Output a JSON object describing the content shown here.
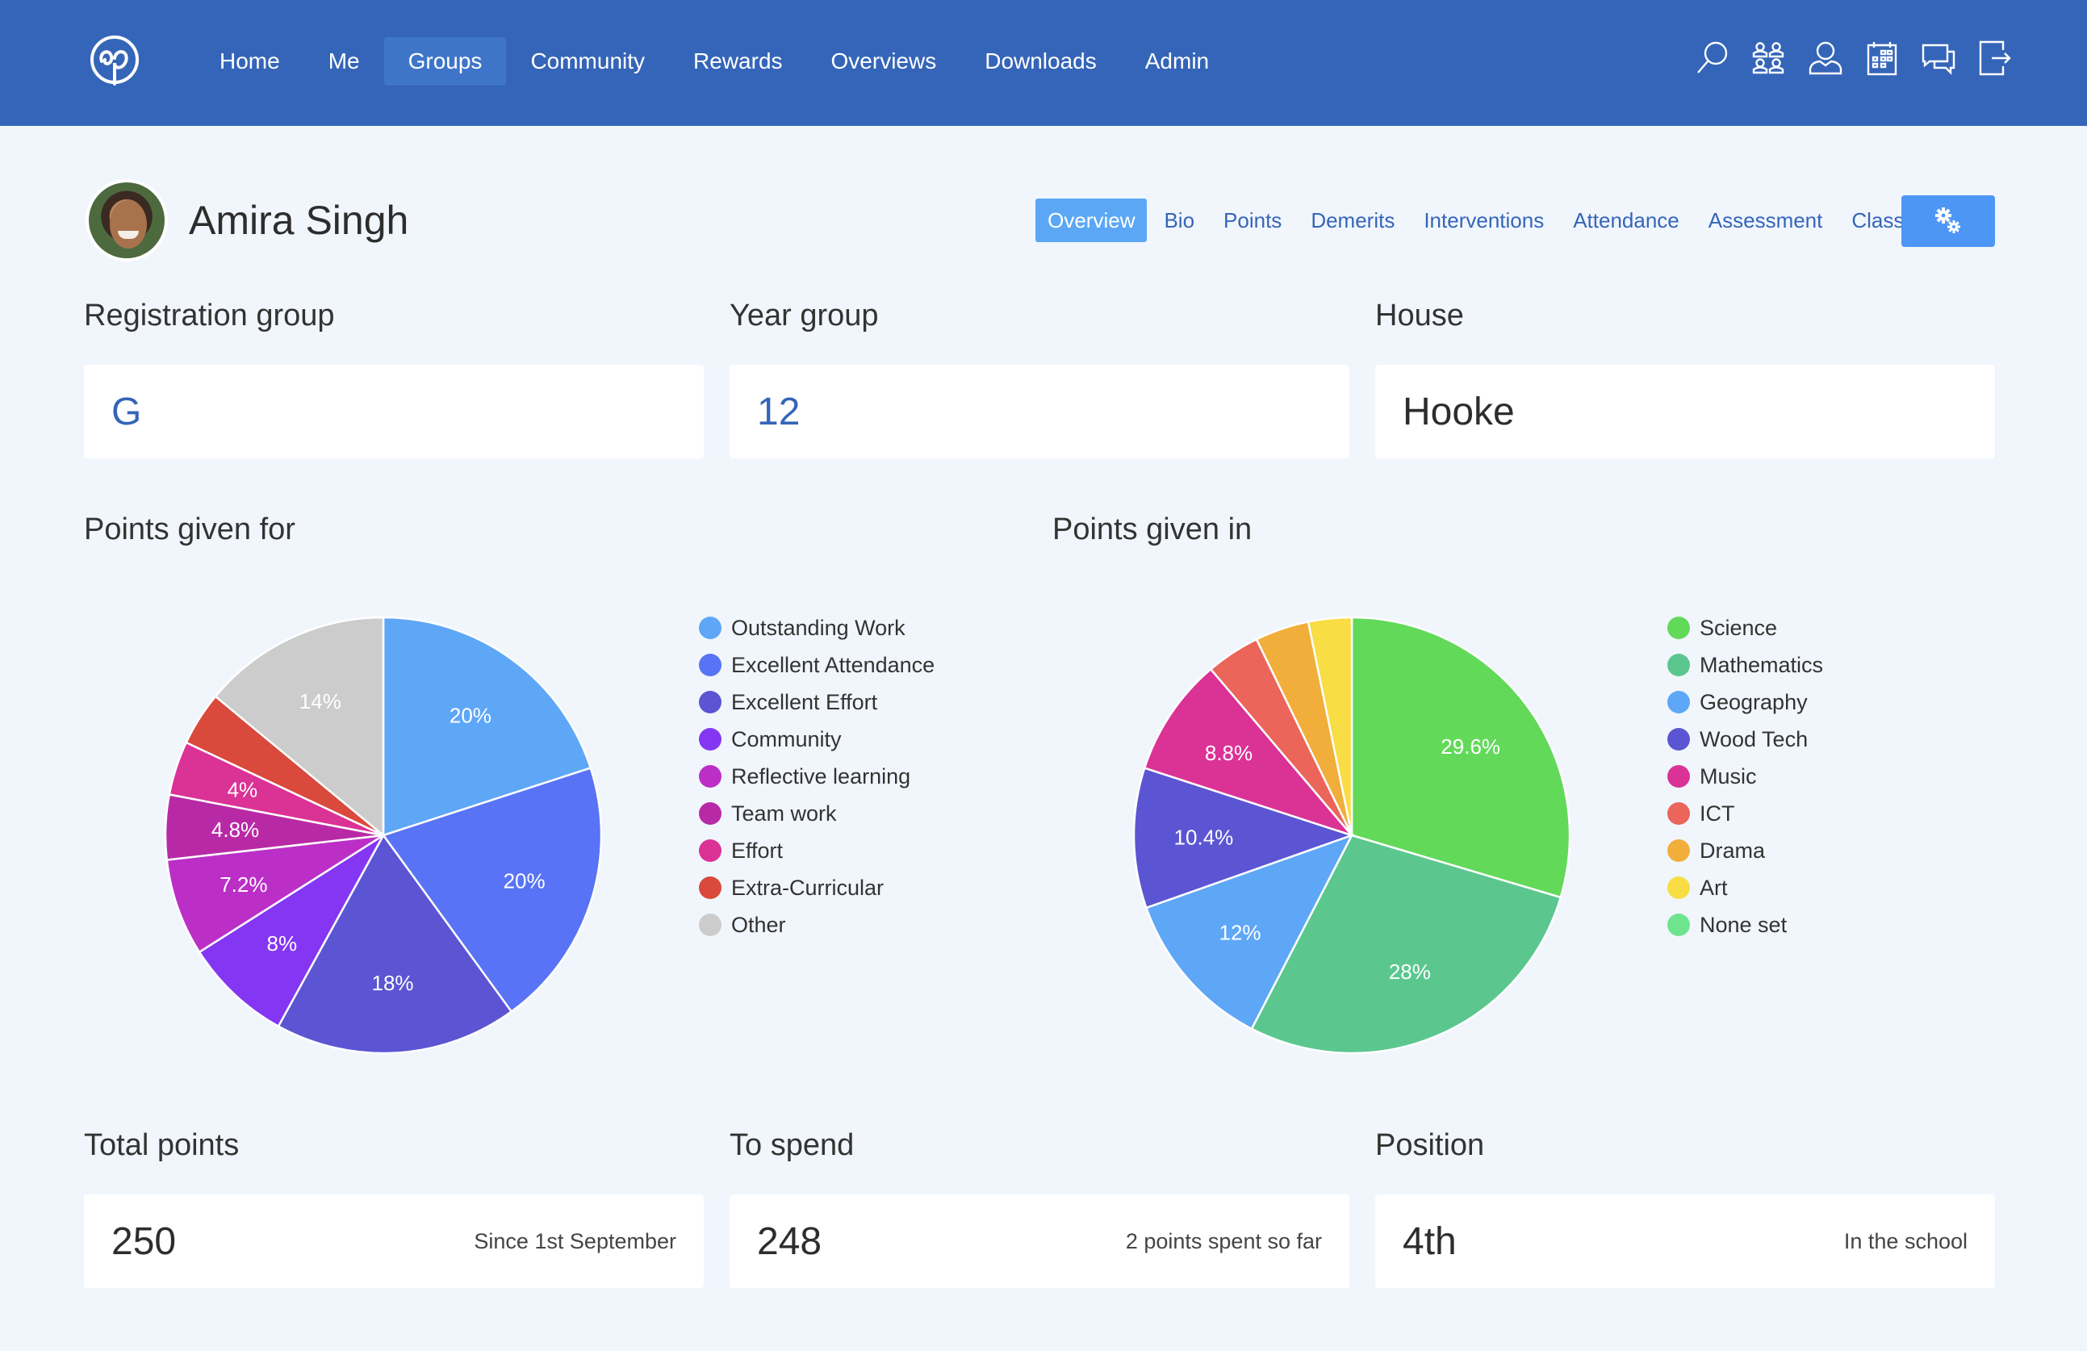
{
  "header": {
    "nav": [
      {
        "label": "Home",
        "active": false
      },
      {
        "label": "Me",
        "active": false
      },
      {
        "label": "Groups",
        "active": true
      },
      {
        "label": "Community",
        "active": false
      },
      {
        "label": "Rewards",
        "active": false
      },
      {
        "label": "Overviews",
        "active": false
      },
      {
        "label": "Downloads",
        "active": false
      },
      {
        "label": "Admin",
        "active": false
      }
    ],
    "icons": [
      "search-icon",
      "groups-icon",
      "user-icon",
      "calendar-icon",
      "messages-icon",
      "logout-icon"
    ],
    "brand_color": "#3565b8"
  },
  "student": {
    "name": "Amira Singh"
  },
  "subnav": {
    "tabs": [
      {
        "label": "Overview",
        "active": true
      },
      {
        "label": "Bio",
        "active": false
      },
      {
        "label": "Points",
        "active": false
      },
      {
        "label": "Demerits",
        "active": false
      },
      {
        "label": "Interventions",
        "active": false
      },
      {
        "label": "Attendance",
        "active": false
      },
      {
        "label": "Assessment",
        "active": false
      },
      {
        "label": "Classnotes",
        "active": false
      }
    ],
    "settings_icon": "gears-icon"
  },
  "info": {
    "registration_group": {
      "label": "Registration group",
      "value": "G"
    },
    "year_group": {
      "label": "Year group",
      "value": "12"
    },
    "house": {
      "label": "House",
      "value": "Hooke"
    }
  },
  "stats": {
    "total_points": {
      "label": "Total points",
      "value": "250",
      "note": "Since 1st September"
    },
    "to_spend": {
      "label": "To spend",
      "value": "248",
      "note": "2 points spent so far"
    },
    "position": {
      "label": "Position",
      "value": "4th",
      "note": "In the school"
    }
  },
  "chart_data": [
    {
      "type": "pie",
      "title": "Points given for",
      "legend": "right",
      "categories": [
        "Outstanding Work",
        "Excellent Attendance",
        "Excellent Effort",
        "Community",
        "Reflective learning",
        "Team work",
        "Effort",
        "Extra-Curricular",
        "Other"
      ],
      "values": [
        20,
        20,
        18,
        8,
        7.2,
        4.8,
        4,
        4,
        14
      ],
      "labels": [
        "20%",
        "20%",
        "18%",
        "8%",
        "7.2%",
        "4.8%",
        "4%",
        "",
        "14%"
      ],
      "colors": [
        "#5ea7f7",
        "#5873f5",
        "#5b55d3",
        "#8436f3",
        "#bb2fc7",
        "#b82aa5",
        "#db3296",
        "#d9493c",
        "#cccccc"
      ]
    },
    {
      "type": "pie",
      "title": "Points given in",
      "legend": "right",
      "categories": [
        "Science",
        "Mathematics",
        "Geography",
        "Wood Tech",
        "Music",
        "ICT",
        "Drama",
        "Art",
        "None set"
      ],
      "values": [
        29.6,
        28,
        12,
        10.4,
        8.8,
        4,
        4,
        3.2,
        0
      ],
      "labels": [
        "29.6%",
        "28%",
        "12%",
        "10.4%",
        "8.8%",
        "",
        "",
        "",
        ""
      ],
      "colors": [
        "#63d95a",
        "#5bc78f",
        "#5ea7f7",
        "#5b55d3",
        "#db3296",
        "#eb655a",
        "#f1ae3a",
        "#f8dd45",
        "#6fe48f"
      ]
    }
  ]
}
